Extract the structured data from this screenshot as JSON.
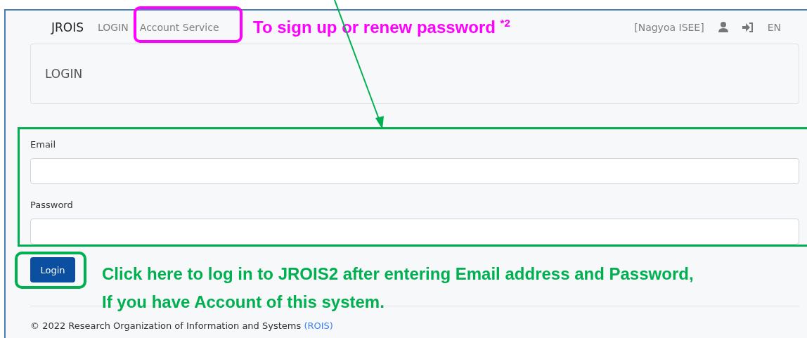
{
  "navbar": {
    "brand": "JROIS",
    "links": [
      {
        "label": "LOGIN"
      },
      {
        "label": "Account Service"
      }
    ],
    "user": "[Nagyoa ISEE]",
    "language": "EN"
  },
  "card": {
    "title": "LOGIN"
  },
  "form": {
    "fields": [
      {
        "label": "Email"
      },
      {
        "label": "Password"
      }
    ],
    "submit": "Login"
  },
  "footer": {
    "text": "© 2022 Research Organization of Information and Systems",
    "link": "(ROIS)"
  },
  "annotations": {
    "account_note": "To sign up or renew password $^{*2}$",
    "login_note": [
      "Click here to log in to JROIS2 after entering Email address and Password,",
      "If you have Account of this system."
    ]
  }
}
